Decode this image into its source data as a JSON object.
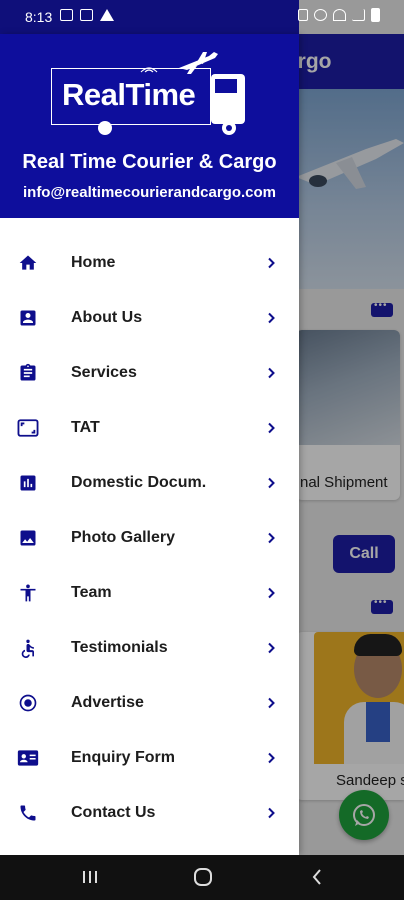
{
  "status_bar": {
    "time": "8:13"
  },
  "background": {
    "header_title_fragment": "argo",
    "card1_caption": "nal Shipment",
    "call_label": "Call",
    "card2_caption": "Sandeep s"
  },
  "drawer": {
    "brand_logo_text": "RealTime",
    "brand_name": "Real Time Courier & Cargo",
    "brand_email": "info@realtimecourierandcargo.com",
    "menu": [
      {
        "label": "Home",
        "icon": "home-icon"
      },
      {
        "label": "About Us",
        "icon": "contact-card-icon"
      },
      {
        "label": "Services",
        "icon": "clipboard-icon"
      },
      {
        "label": "TAT",
        "icon": "aspect-ratio-icon"
      },
      {
        "label": "Domestic Docum.",
        "icon": "bar-chart-icon"
      },
      {
        "label": "Photo Gallery",
        "icon": "image-icon"
      },
      {
        "label": "Team",
        "icon": "person-icon"
      },
      {
        "label": "Testimonials",
        "icon": "accessible-icon"
      },
      {
        "label": "Advertise",
        "icon": "radio-button-icon"
      },
      {
        "label": "Enquiry Form",
        "icon": "id-card-icon"
      },
      {
        "label": "Contact Us",
        "icon": "phone-icon"
      }
    ]
  },
  "colors": {
    "brand": "#0e0e9c",
    "icon": "#0e0e8c",
    "whatsapp": "#1fa33c"
  }
}
